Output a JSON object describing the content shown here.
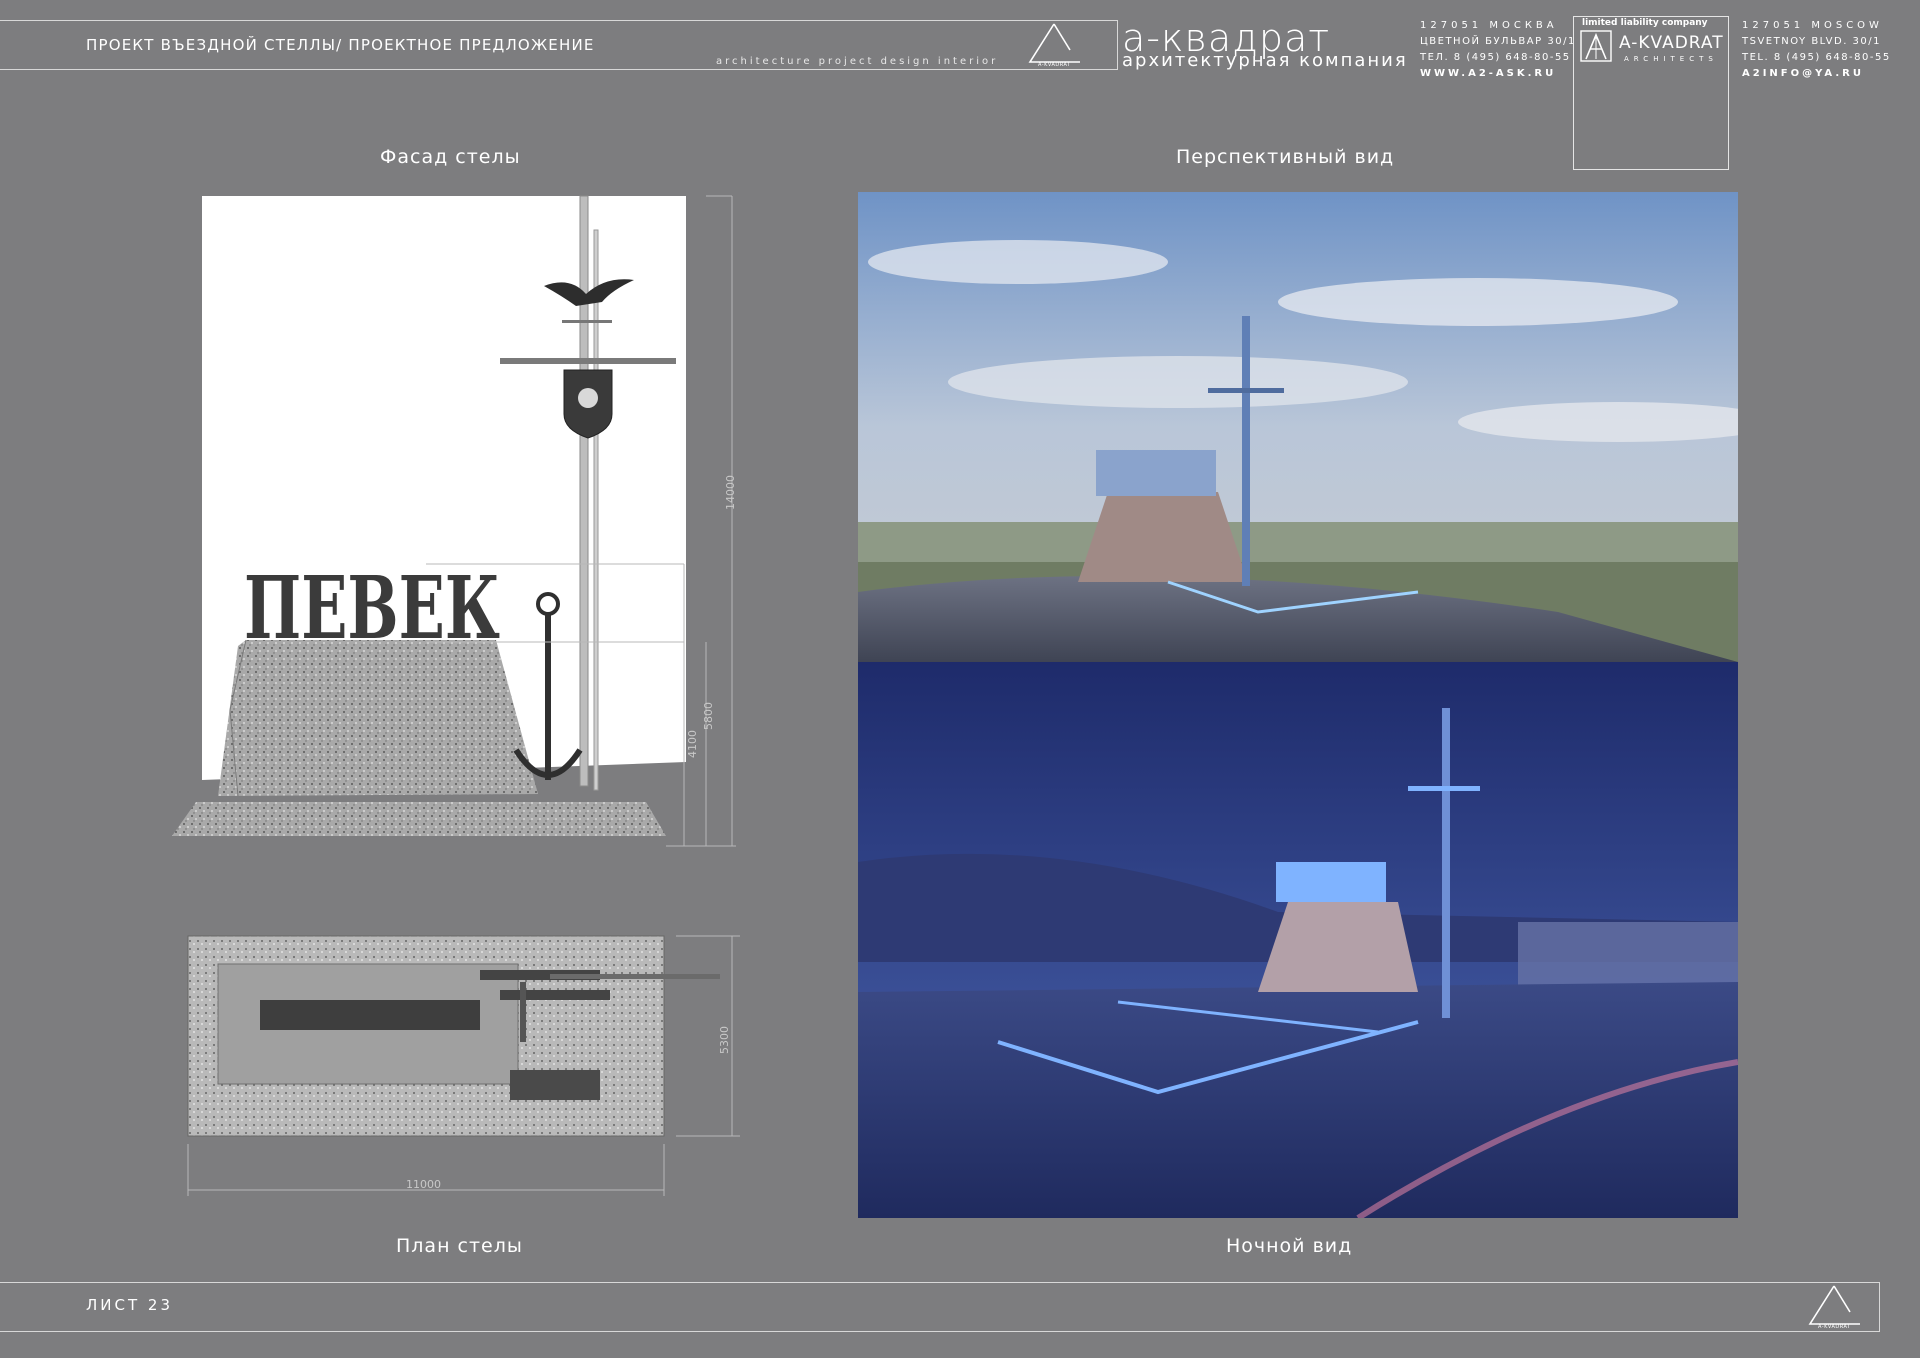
{
  "header": {
    "project_title": "ПРОЕКТ ВЪЕЗДНОЙ СТЕЛЛЫ/ ПРОЕКТНОЕ ПРЕДЛОЖЕНИЕ",
    "tagline": "architecture   project   design   interior",
    "logo_caption": "A-KVADRAT",
    "brand_name": "а-квадрат",
    "brand_sub": "архитектурная компания",
    "contacts_ru": {
      "city": "127051 МОСКВА",
      "address": "ЦВЕТНОЙ БУЛЬВАР 30/1",
      "phone": "ТЕЛ. 8 (495) 648-80-55",
      "url": "WWW.A2-ASK.RU"
    },
    "company": {
      "label": "limited liability company",
      "name": "A-KVADRAT",
      "sub": "ARCHITECTS"
    },
    "contacts_en": {
      "city": "127051 MOSCOW",
      "address": "TSVETNOY BLVD. 30/1",
      "phone": "TEL. 8 (495) 648-80-55",
      "email": "A2INFO@YA.RU"
    }
  },
  "sections": {
    "facade": "Фасад стелы",
    "perspective": "Перспективный вид",
    "plan": "План стелы",
    "night": "Ночной вид"
  },
  "drawing": {
    "city_name": "ПЕВЕК",
    "dim_total": "14000",
    "dim_letters": "5800",
    "dim_base": "4100",
    "dim_plan_width": "5300",
    "dim_plan_length": "11000"
  },
  "footer": {
    "sheet_label": "ЛИСТ 23"
  },
  "colors": {
    "page_bg": "#7d7d7f",
    "line": "#d8d8d8",
    "night_glow": "#7fb3ff"
  }
}
